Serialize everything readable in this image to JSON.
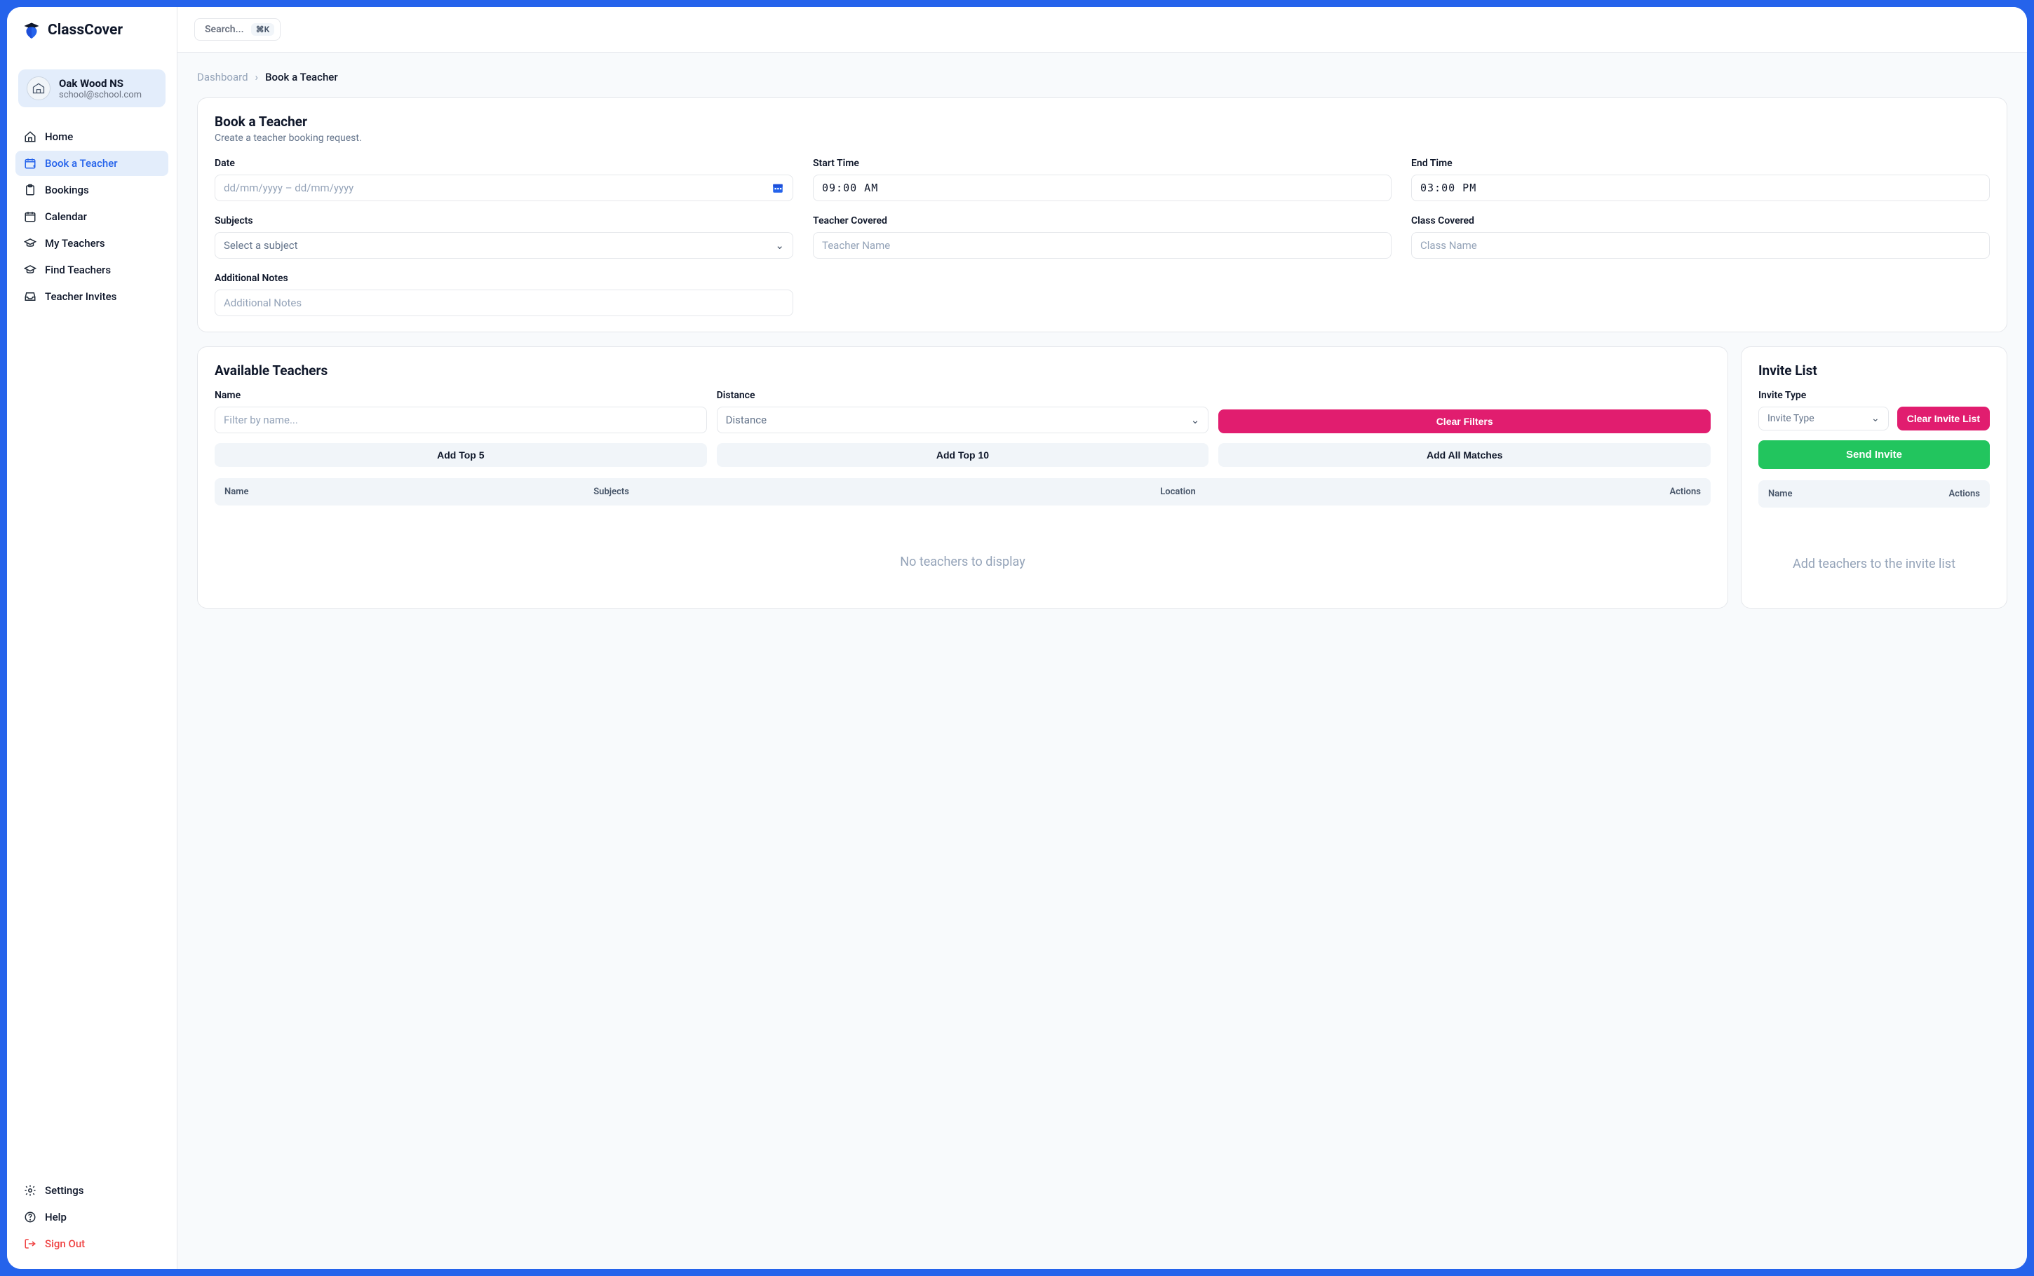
{
  "app": {
    "name": "ClassCover"
  },
  "search": {
    "placeholder": "Search...",
    "shortcut": "⌘K"
  },
  "profile": {
    "name": "Oak Wood NS",
    "email": "school@school.com"
  },
  "nav": {
    "home": "Home",
    "book": "Book a Teacher",
    "bookings": "Bookings",
    "calendar": "Calendar",
    "myteachers": "My Teachers",
    "findteachers": "Find Teachers",
    "invites": "Teacher Invites"
  },
  "footer_nav": {
    "settings": "Settings",
    "help": "Help",
    "signout": "Sign Out"
  },
  "breadcrumb": {
    "root": "Dashboard",
    "current": "Book a Teacher"
  },
  "form": {
    "title": "Book a Teacher",
    "subtitle": "Create a teacher booking request.",
    "labels": {
      "date": "Date",
      "start_time": "Start Time",
      "end_time": "End Time",
      "subjects": "Subjects",
      "teacher_covered": "Teacher Covered",
      "class_covered": "Class Covered",
      "notes": "Additional Notes"
    },
    "placeholders": {
      "date": "dd/mm/yyyy – dd/mm/yyyy",
      "subjects": "Select a subject",
      "teacher_covered": "Teacher Name",
      "class_covered": "Class Name",
      "notes": "Additional Notes"
    },
    "values": {
      "start_time": "09:00 AM",
      "end_time": "03:00 PM"
    }
  },
  "available": {
    "title": "Available Teachers",
    "labels": {
      "name": "Name",
      "distance": "Distance"
    },
    "placeholders": {
      "name": "Filter by name...",
      "distance": "Distance"
    },
    "buttons": {
      "clear": "Clear Filters",
      "top5": "Add Top 5",
      "top10": "Add Top 10",
      "all": "Add All Matches"
    },
    "columns": {
      "name": "Name",
      "subjects": "Subjects",
      "location": "Location",
      "actions": "Actions"
    },
    "empty": "No teachers to display"
  },
  "invite": {
    "title": "Invite List",
    "labels": {
      "type": "Invite Type"
    },
    "placeholders": {
      "type": "Invite Type"
    },
    "buttons": {
      "clear": "Clear Invite List",
      "send": "Send Invite"
    },
    "columns": {
      "name": "Name",
      "actions": "Actions"
    },
    "empty": "Add teachers to the invite list"
  }
}
